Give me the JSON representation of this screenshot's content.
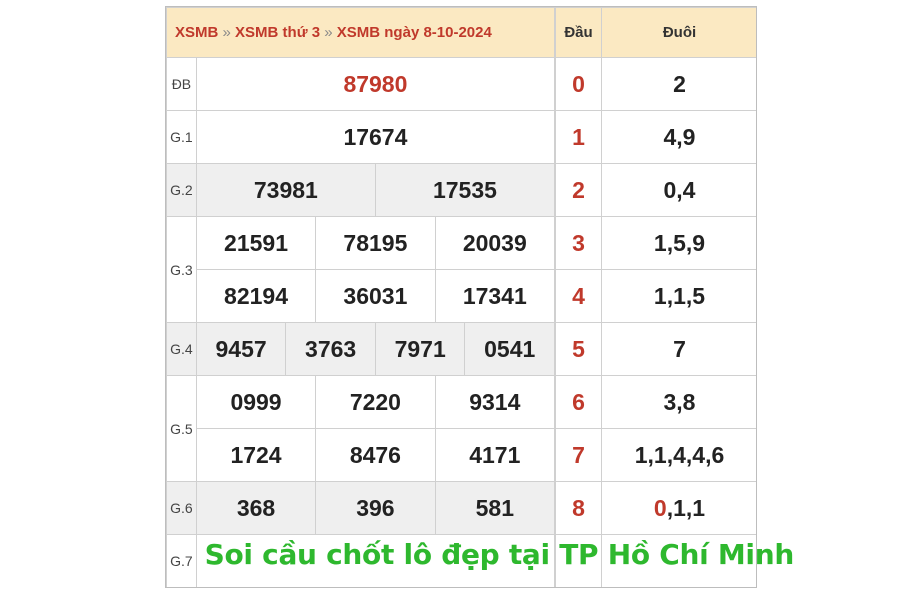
{
  "header": {
    "crumb1": "XSMB",
    "crumb2": "XSMB thứ 3",
    "crumb3": "XSMB ngày 8-10-2024",
    "separator": "»",
    "col_dau": "Đầu",
    "col_duoi": "Đuôi"
  },
  "prizes": {
    "db": {
      "label": "ĐB",
      "numbers": [
        "87980"
      ]
    },
    "g1": {
      "label": "G.1",
      "numbers": [
        "17674"
      ]
    },
    "g2": {
      "label": "G.2",
      "numbers": [
        "73981",
        "17535"
      ]
    },
    "g3": {
      "label": "G.3",
      "numbers": [
        "21591",
        "78195",
        "20039",
        "82194",
        "36031",
        "17341"
      ]
    },
    "g4": {
      "label": "G.4",
      "numbers": [
        "9457",
        "3763",
        "7971",
        "0541"
      ]
    },
    "g5": {
      "label": "G.5",
      "numbers": [
        "0999",
        "7220",
        "9314",
        "1724",
        "8476",
        "4171"
      ]
    },
    "g6": {
      "label": "G.6",
      "numbers": [
        "368",
        "396",
        "581"
      ]
    },
    "g7": {
      "label": "G.7"
    }
  },
  "loto": [
    {
      "dau": "0",
      "duoi": "2"
    },
    {
      "dau": "1",
      "duoi": "4,9"
    },
    {
      "dau": "2",
      "duoi": "0,4"
    },
    {
      "dau": "3",
      "duoi": "1,5,9"
    },
    {
      "dau": "4",
      "duoi": "1,1,5"
    },
    {
      "dau": "5",
      "duoi": "7"
    },
    {
      "dau": "6",
      "duoi": "3,8"
    },
    {
      "dau": "7",
      "duoi": "1,1,4,4,6"
    },
    {
      "dau": "8",
      "duoi_highlight": "0",
      "duoi_rest": ",1,1"
    }
  ],
  "banner": "Soi cầu chốt lô đẹp tại TP Hồ Chí Minh",
  "colors": {
    "red": "#c0392b",
    "header_bg": "#fbe9c2",
    "row_grey": "#efefef",
    "banner_green": "#2eb82e"
  }
}
